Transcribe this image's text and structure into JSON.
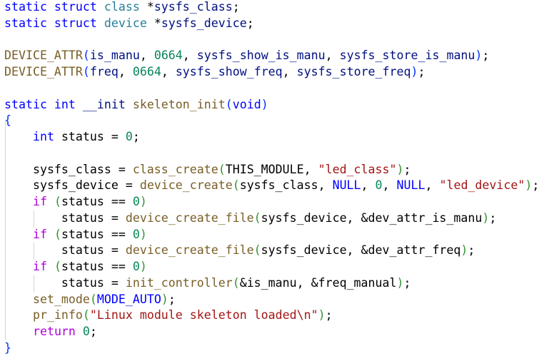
{
  "colors": {
    "keyword": "#0000ff",
    "type": "#267f99",
    "variable": "#001080",
    "function": "#795e26",
    "number": "#098658",
    "control": "#af00db",
    "string": "#a31515"
  },
  "lines": [
    {
      "tokens": [
        {
          "t": "static struct ",
          "c": "k"
        },
        {
          "t": "class",
          "c": "t"
        },
        {
          "t": " *",
          "c": "p"
        },
        {
          "t": "sysfs_class",
          "c": "v"
        },
        {
          "t": ";",
          "c": "p"
        }
      ]
    },
    {
      "tokens": [
        {
          "t": "static struct ",
          "c": "k"
        },
        {
          "t": "device",
          "c": "t"
        },
        {
          "t": " *",
          "c": "p"
        },
        {
          "t": "sysfs_device",
          "c": "v"
        },
        {
          "t": ";",
          "c": "p"
        }
      ]
    },
    {
      "tokens": []
    },
    {
      "tokens": [
        {
          "t": "DEVICE_ATTR",
          "c": "f"
        },
        {
          "t": "(",
          "c": "b1"
        },
        {
          "t": "is_manu",
          "c": "v"
        },
        {
          "t": ", ",
          "c": "p"
        },
        {
          "t": "0664",
          "c": "n"
        },
        {
          "t": ", ",
          "c": "p"
        },
        {
          "t": "sysfs_show_is_manu",
          "c": "v"
        },
        {
          "t": ", ",
          "c": "p"
        },
        {
          "t": "sysfs_store_is_manu",
          "c": "v"
        },
        {
          "t": ")",
          "c": "b1"
        },
        {
          "t": ";",
          "c": "p"
        }
      ]
    },
    {
      "tokens": [
        {
          "t": "DEVICE_ATTR",
          "c": "f"
        },
        {
          "t": "(",
          "c": "b1"
        },
        {
          "t": "freq",
          "c": "v"
        },
        {
          "t": ", ",
          "c": "p"
        },
        {
          "t": "0664",
          "c": "n"
        },
        {
          "t": ", ",
          "c": "p"
        },
        {
          "t": "sysfs_show_freq",
          "c": "v"
        },
        {
          "t": ", ",
          "c": "p"
        },
        {
          "t": "sysfs_store_freq",
          "c": "v"
        },
        {
          "t": ")",
          "c": "b1"
        },
        {
          "t": ";",
          "c": "p"
        }
      ]
    },
    {
      "tokens": []
    },
    {
      "tokens": [
        {
          "t": "static int ",
          "c": "k"
        },
        {
          "t": "__init ",
          "c": "v"
        },
        {
          "t": "skeleton_init",
          "c": "f"
        },
        {
          "t": "(",
          "c": "b1"
        },
        {
          "t": "void",
          "c": "k"
        },
        {
          "t": ")",
          "c": "b1"
        }
      ]
    },
    {
      "tokens": [
        {
          "t": "{",
          "c": "b1"
        }
      ]
    },
    {
      "tokens": [
        {
          "t": "    ",
          "c": "p"
        },
        {
          "t": "int",
          "c": "k"
        },
        {
          "t": " status = ",
          "c": "p"
        },
        {
          "t": "0",
          "c": "n"
        },
        {
          "t": ";",
          "c": "p"
        }
      ]
    },
    {
      "tokens": []
    },
    {
      "tokens": [
        {
          "t": "    sysfs_class = ",
          "c": "p"
        },
        {
          "t": "class_create",
          "c": "f"
        },
        {
          "t": "(",
          "c": "b2"
        },
        {
          "t": "THIS_MODULE, ",
          "c": "p"
        },
        {
          "t": "\"led_class\"",
          "c": "s"
        },
        {
          "t": ")",
          "c": "b2"
        },
        {
          "t": ";",
          "c": "p"
        }
      ]
    },
    {
      "tokens": [
        {
          "t": "    sysfs_device = ",
          "c": "p"
        },
        {
          "t": "device_create",
          "c": "f"
        },
        {
          "t": "(",
          "c": "b2"
        },
        {
          "t": "sysfs_class, ",
          "c": "p"
        },
        {
          "t": "NULL",
          "c": "k"
        },
        {
          "t": ", ",
          "c": "p"
        },
        {
          "t": "0",
          "c": "n"
        },
        {
          "t": ", ",
          "c": "p"
        },
        {
          "t": "NULL",
          "c": "k"
        },
        {
          "t": ", ",
          "c": "p"
        },
        {
          "t": "\"led_device\"",
          "c": "s"
        },
        {
          "t": ")",
          "c": "b2"
        },
        {
          "t": ";",
          "c": "p"
        }
      ]
    },
    {
      "tokens": [
        {
          "t": "    ",
          "c": "p"
        },
        {
          "t": "if",
          "c": "c"
        },
        {
          "t": " ",
          "c": "p"
        },
        {
          "t": "(",
          "c": "b2"
        },
        {
          "t": "status == ",
          "c": "p"
        },
        {
          "t": "0",
          "c": "n"
        },
        {
          "t": ")",
          "c": "b2"
        }
      ]
    },
    {
      "tokens": [
        {
          "t": "        status = ",
          "c": "p"
        },
        {
          "t": "device_create_file",
          "c": "f"
        },
        {
          "t": "(",
          "c": "b2"
        },
        {
          "t": "sysfs_device, &dev_attr_is_manu",
          "c": "p"
        },
        {
          "t": ")",
          "c": "b2"
        },
        {
          "t": ";",
          "c": "p"
        }
      ]
    },
    {
      "tokens": [
        {
          "t": "    ",
          "c": "p"
        },
        {
          "t": "if",
          "c": "c"
        },
        {
          "t": " ",
          "c": "p"
        },
        {
          "t": "(",
          "c": "b2"
        },
        {
          "t": "status == ",
          "c": "p"
        },
        {
          "t": "0",
          "c": "n"
        },
        {
          "t": ")",
          "c": "b2"
        }
      ]
    },
    {
      "tokens": [
        {
          "t": "        status = ",
          "c": "p"
        },
        {
          "t": "device_create_file",
          "c": "f"
        },
        {
          "t": "(",
          "c": "b2"
        },
        {
          "t": "sysfs_device, &dev_attr_freq",
          "c": "p"
        },
        {
          "t": ")",
          "c": "b2"
        },
        {
          "t": ";",
          "c": "p"
        }
      ]
    },
    {
      "tokens": [
        {
          "t": "    ",
          "c": "p"
        },
        {
          "t": "if",
          "c": "c"
        },
        {
          "t": " ",
          "c": "p"
        },
        {
          "t": "(",
          "c": "b2"
        },
        {
          "t": "status == ",
          "c": "p"
        },
        {
          "t": "0",
          "c": "n"
        },
        {
          "t": ")",
          "c": "b2"
        }
      ]
    },
    {
      "tokens": [
        {
          "t": "        status = ",
          "c": "p"
        },
        {
          "t": "init_controller",
          "c": "f"
        },
        {
          "t": "(",
          "c": "b2"
        },
        {
          "t": "&is_manu, &freq_manual",
          "c": "p"
        },
        {
          "t": ")",
          "c": "b2"
        },
        {
          "t": ";",
          "c": "p"
        }
      ]
    },
    {
      "tokens": [
        {
          "t": "    ",
          "c": "p"
        },
        {
          "t": "set_mode",
          "c": "f"
        },
        {
          "t": "(",
          "c": "b2"
        },
        {
          "t": "MODE_AUTO",
          "c": "k"
        },
        {
          "t": ")",
          "c": "b2"
        },
        {
          "t": ";",
          "c": "p"
        }
      ]
    },
    {
      "tokens": [
        {
          "t": "    ",
          "c": "p"
        },
        {
          "t": "pr_info",
          "c": "f"
        },
        {
          "t": "(",
          "c": "b2"
        },
        {
          "t": "\"Linux module skeleton loaded\\n\"",
          "c": "s"
        },
        {
          "t": ")",
          "c": "b2"
        },
        {
          "t": ";",
          "c": "p"
        }
      ]
    },
    {
      "tokens": [
        {
          "t": "    ",
          "c": "p"
        },
        {
          "t": "return",
          "c": "c"
        },
        {
          "t": " ",
          "c": "p"
        },
        {
          "t": "0",
          "c": "n"
        },
        {
          "t": ";",
          "c": "p"
        }
      ]
    },
    {
      "tokens": [
        {
          "t": "}",
          "c": "b1"
        }
      ]
    }
  ]
}
